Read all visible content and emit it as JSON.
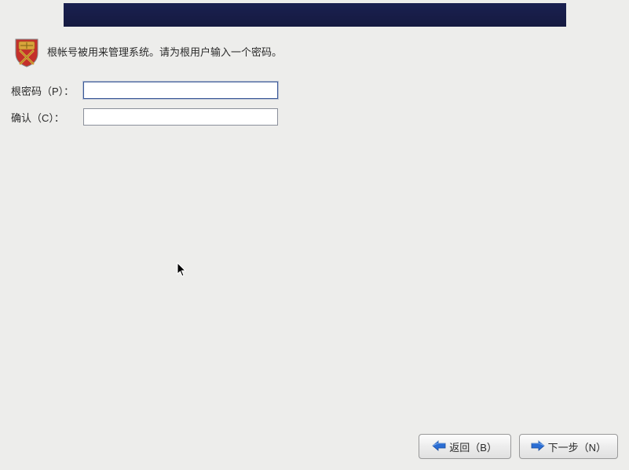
{
  "description": "根帐号被用来管理系统。请为根用户输入一个密码。",
  "form": {
    "password_label": "根密码（P）：",
    "confirm_label": "确认（C）：",
    "password_value": "",
    "confirm_value": ""
  },
  "buttons": {
    "back_label": "返回（B）",
    "next_label": "下一步（N）"
  },
  "icons": {
    "shield": "shield-icon",
    "arrow_left": "arrow-left-icon",
    "arrow_right": "arrow-right-icon"
  },
  "colors": {
    "header_bg": "#151a40",
    "page_bg": "#ededeb",
    "arrow_blue": "#2a6dd4",
    "shield_red": "#c4302b",
    "shield_yellow": "#d9a43b"
  }
}
